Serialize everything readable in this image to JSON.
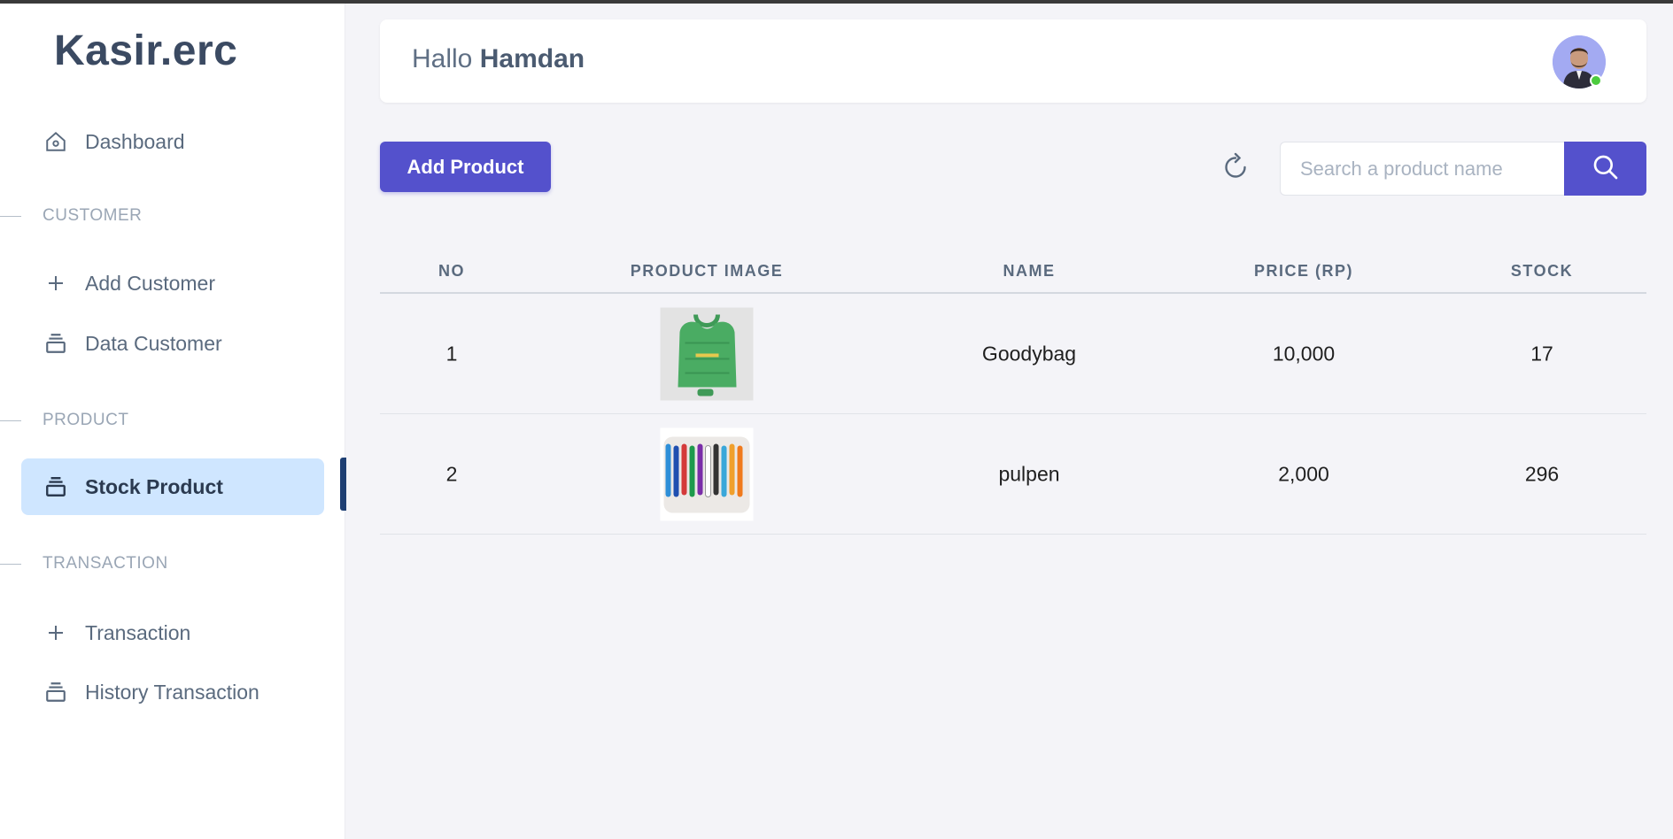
{
  "brand": "Kasir.erc",
  "sidebar": {
    "dashboard": "Dashboard",
    "sections": {
      "customer": "CUSTOMER",
      "product": "PRODUCT",
      "transaction": "TRANSACTION"
    },
    "items": {
      "add_customer": "Add Customer",
      "data_customer": "Data Customer",
      "stock_product": "Stock Product",
      "transaction": "Transaction",
      "history_transaction": "History Transaction"
    },
    "active": "stock_product"
  },
  "header": {
    "greeting_prefix": "Hallo",
    "user_name": "Hamdan",
    "status": "online"
  },
  "toolbar": {
    "add_label": "Add Product",
    "search_placeholder": "Search a product name",
    "search_value": ""
  },
  "table": {
    "columns": [
      "NO",
      "PRODUCT IMAGE",
      "NAME",
      "PRICE (RP)",
      "STOCK"
    ],
    "rows": [
      {
        "no": "1",
        "image": "green-goodybag",
        "name": "Goodybag",
        "price": "10,000",
        "stock": "17"
      },
      {
        "no": "2",
        "image": "colorful-pens",
        "name": "pulpen",
        "price": "2,000",
        "stock": "296"
      }
    ]
  },
  "colors": {
    "accent": "#5451cc",
    "active_bg": "#cfe6ff",
    "brand_text": "#3b4a62",
    "online": "#4ccb3e"
  }
}
